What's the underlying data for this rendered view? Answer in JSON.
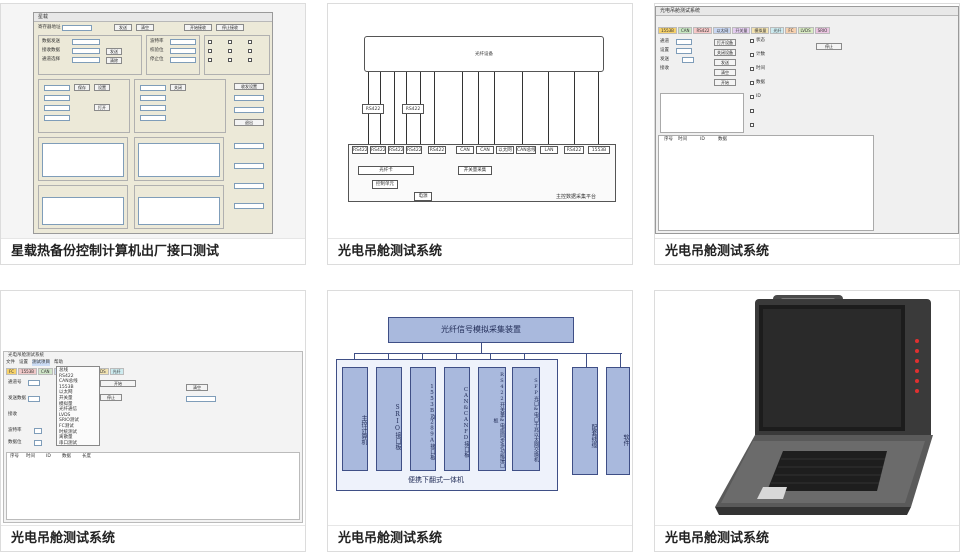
{
  "cards": [
    {
      "caption": "星载热备份控制计算机出厂接口测试",
      "screen": {
        "title": "星载",
        "labels": [
          "寄存器地址",
          "数据发送",
          "接收数据",
          "发送",
          "清除",
          "通道选择",
          "波特率",
          "校验位",
          "停止位",
          "收发设置"
        ],
        "buttons": [
          "发送",
          "清空",
          "开始接收",
          "停止接收",
          "保存",
          "设置",
          "退出",
          "打开",
          "关闭"
        ]
      }
    },
    {
      "caption": "光电吊舱测试系统",
      "diagram": {
        "top_label": "光纤设备",
        "bottom_label": "主控数据采集平台",
        "module_labels": [
          "RS422",
          "RS422",
          "RS422",
          "RS422",
          "RS422",
          "RS422",
          "RS422",
          "CAN",
          "CAN",
          "以太网",
          "CAN总线",
          "LAN",
          "RS422",
          "1553B"
        ],
        "sub_labels": [
          "光纤卡",
          "开关量采集",
          "控制单元",
          "电源"
        ]
      }
    },
    {
      "caption": "光电吊舱测试系统",
      "screen": {
        "title": "光电吊舱测试系统",
        "tabs": [
          "1553B",
          "CAN",
          "RS422",
          "以太网",
          "开关量",
          "模拟量",
          "光纤",
          "FC",
          "LVDS",
          "SRIO"
        ],
        "labels": [
          "通道",
          "设置",
          "发送",
          "接收",
          "状态",
          "计数",
          "时间",
          "数据",
          "ID"
        ],
        "buttons": [
          "打开设备",
          "关闭设备",
          "发送",
          "清空",
          "开始",
          "停止"
        ],
        "table_headers": [
          "序号",
          "时间",
          "ID",
          "数据"
        ]
      }
    },
    {
      "caption": "光电吊舱测试系统",
      "screen": {
        "title": "光电吊舱测试系统",
        "menu": [
          "文件",
          "设置",
          "测试项目",
          "帮助"
        ],
        "dropdown": [
          "总线",
          "RS422",
          "CAN总线",
          "1553B",
          "以太网",
          "开关量",
          "模拟量",
          "光纤通信",
          "LVDS",
          "SRIO测试",
          "FC测试",
          "时统测试",
          "离散量",
          "串口测试"
        ],
        "tabs": [
          "FC",
          "1553B",
          "CAN",
          "RS422",
          "以太网",
          "LVDS",
          "光纤"
        ],
        "labels": [
          "通道号",
          "发送数据",
          "接收",
          "波特率",
          "数据位"
        ],
        "buttons": [
          "开始",
          "停止",
          "清空"
        ],
        "table_headers": [
          "序号",
          "时间",
          "ID",
          "数据",
          "长度"
        ]
      }
    },
    {
      "caption": "光电吊舱测试系统",
      "diagram": {
        "top_label": "光纤信号模拟采集装置",
        "modules": [
          "主控计算机",
          "SRIO接口板",
          "1553B及289A接口板",
          "CAN&CANFD接口板",
          "RS422开关量&电缆同步多功能接口板",
          "SFP光口&电口千兆以太网交换机"
        ],
        "side_modules": [
          "配套线缆",
          "软件"
        ],
        "bottom_label": "便携下翻式一体机"
      }
    },
    {
      "caption": "光电吊舱测试系统",
      "photo": {
        "subject": "portable rugged laptop computer with handle and keyboard"
      }
    }
  ]
}
